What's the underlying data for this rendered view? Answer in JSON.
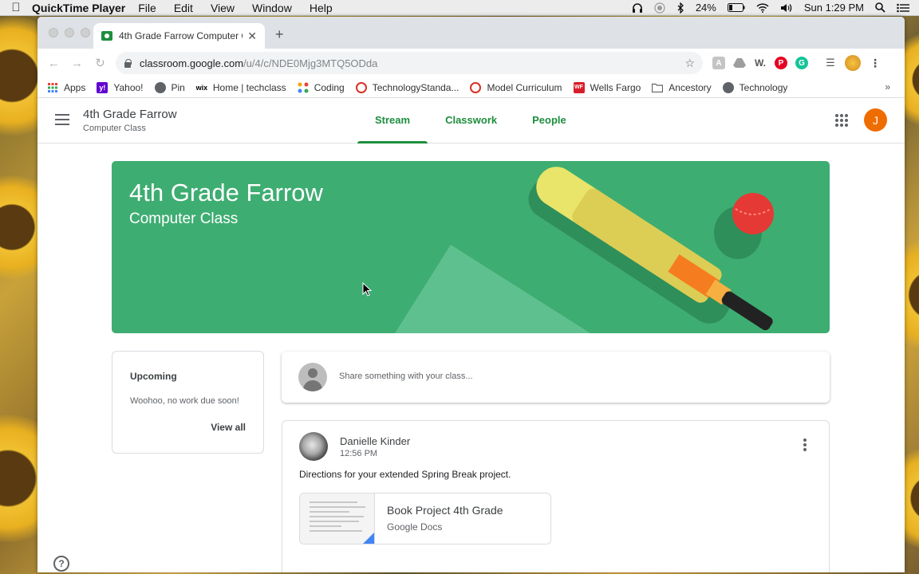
{
  "menubar": {
    "app_name": "QuickTime Player",
    "menus": [
      "File",
      "Edit",
      "View",
      "Window",
      "Help"
    ],
    "battery": "24%",
    "clock": "Sun 1:29 PM"
  },
  "browser": {
    "tab_title": "4th Grade Farrow Computer Cl...",
    "url_host": "classroom.google.com",
    "url_path": "/u/4/c/NDE0Mjg3MTQ5ODda",
    "bookmarks": [
      {
        "label": "Apps",
        "icon": "apps-grid-icon",
        "color": "#e94235"
      },
      {
        "label": "Yahoo!",
        "icon": "yahoo-icon",
        "color": "#6001d2"
      },
      {
        "label": "Pin",
        "icon": "globe-icon",
        "color": "#5f6368"
      },
      {
        "label": "Home | techclass",
        "icon": "wix-icon",
        "color": "#000000"
      },
      {
        "label": "Coding",
        "icon": "joomla-icon",
        "color": "#f4a300"
      },
      {
        "label": "TechnologyStanda...",
        "icon": "circle-icon",
        "color": "#d93025"
      },
      {
        "label": "Model Curriculum",
        "icon": "circle-icon",
        "color": "#d93025"
      },
      {
        "label": "Wells Fargo",
        "icon": "wells-fargo-icon",
        "color": "#d71e28"
      },
      {
        "label": "Ancestory",
        "icon": "folder-icon",
        "color": "#5f6368"
      },
      {
        "label": "Technology",
        "icon": "globe-icon",
        "color": "#5f6368"
      }
    ],
    "bookmarks_more": "»"
  },
  "classroom": {
    "class_name": "4th Grade Farrow",
    "class_section": "Computer Class",
    "tabs": [
      {
        "label": "Stream",
        "active": true
      },
      {
        "label": "Classwork",
        "active": false
      },
      {
        "label": "People",
        "active": false
      }
    ],
    "avatar_letter": "J",
    "banner": {
      "title": "4th Grade Farrow",
      "subtitle": "Computer Class",
      "color": "#3ead72"
    },
    "upcoming": {
      "title": "Upcoming",
      "empty_text": "Woohoo, no work due soon!",
      "view_all": "View all"
    },
    "share_placeholder": "Share something with your class...",
    "post": {
      "author": "Danielle Kinder",
      "time": "12:56 PM",
      "body": "Directions for your extended Spring Break project.",
      "attachment": {
        "title": "Book Project 4th Grade",
        "type": "Google Docs"
      }
    }
  }
}
